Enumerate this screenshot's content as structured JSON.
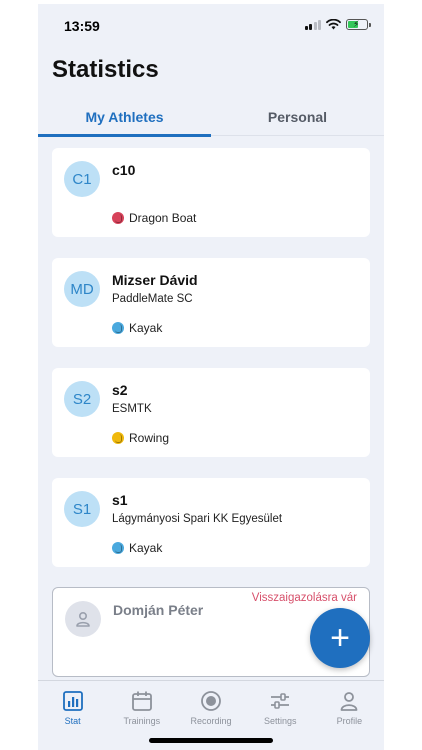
{
  "status_bar": {
    "time": "13:59"
  },
  "page": {
    "title": "Statistics"
  },
  "tabs": [
    {
      "label": "My Athletes",
      "active": true
    },
    {
      "label": "Personal",
      "active": false
    }
  ],
  "athletes": [
    {
      "initials": "C1",
      "name": "c10",
      "club": "",
      "sport": "Dragon Boat",
      "sport_icon": "dragon-boat-icon"
    },
    {
      "initials": "MD",
      "name": "Mizser Dávid",
      "club": "PaddleMate SC",
      "sport": "Kayak",
      "sport_icon": "kayak-icon"
    },
    {
      "initials": "S2",
      "name": "s2",
      "club": "ESMTK",
      "sport": "Rowing",
      "sport_icon": "rowing-icon"
    },
    {
      "initials": "S1",
      "name": "s1",
      "club": "Lágymányosi Spari KK Egyesület",
      "sport": "Kayak",
      "sport_icon": "kayak-icon"
    }
  ],
  "pending": {
    "name": "Domján Péter",
    "badge": "Visszaigazolásra vár",
    "avatar_icon": "person-icon"
  },
  "fab": {
    "label": "+",
    "icon": "plus-icon"
  },
  "bottom_nav": [
    {
      "label": "Stat",
      "icon": "bar-chart-icon",
      "active": true
    },
    {
      "label": "Trainings",
      "icon": "calendar-icon",
      "active": false
    },
    {
      "label": "Recording",
      "icon": "record-icon",
      "active": false
    },
    {
      "label": "Settings",
      "icon": "sliders-icon",
      "active": false
    },
    {
      "label": "Profile",
      "icon": "person-icon",
      "active": false
    }
  ],
  "colors": {
    "accent": "#1f6fbf",
    "pending": "#d7506b",
    "background": "#eef1f8"
  }
}
